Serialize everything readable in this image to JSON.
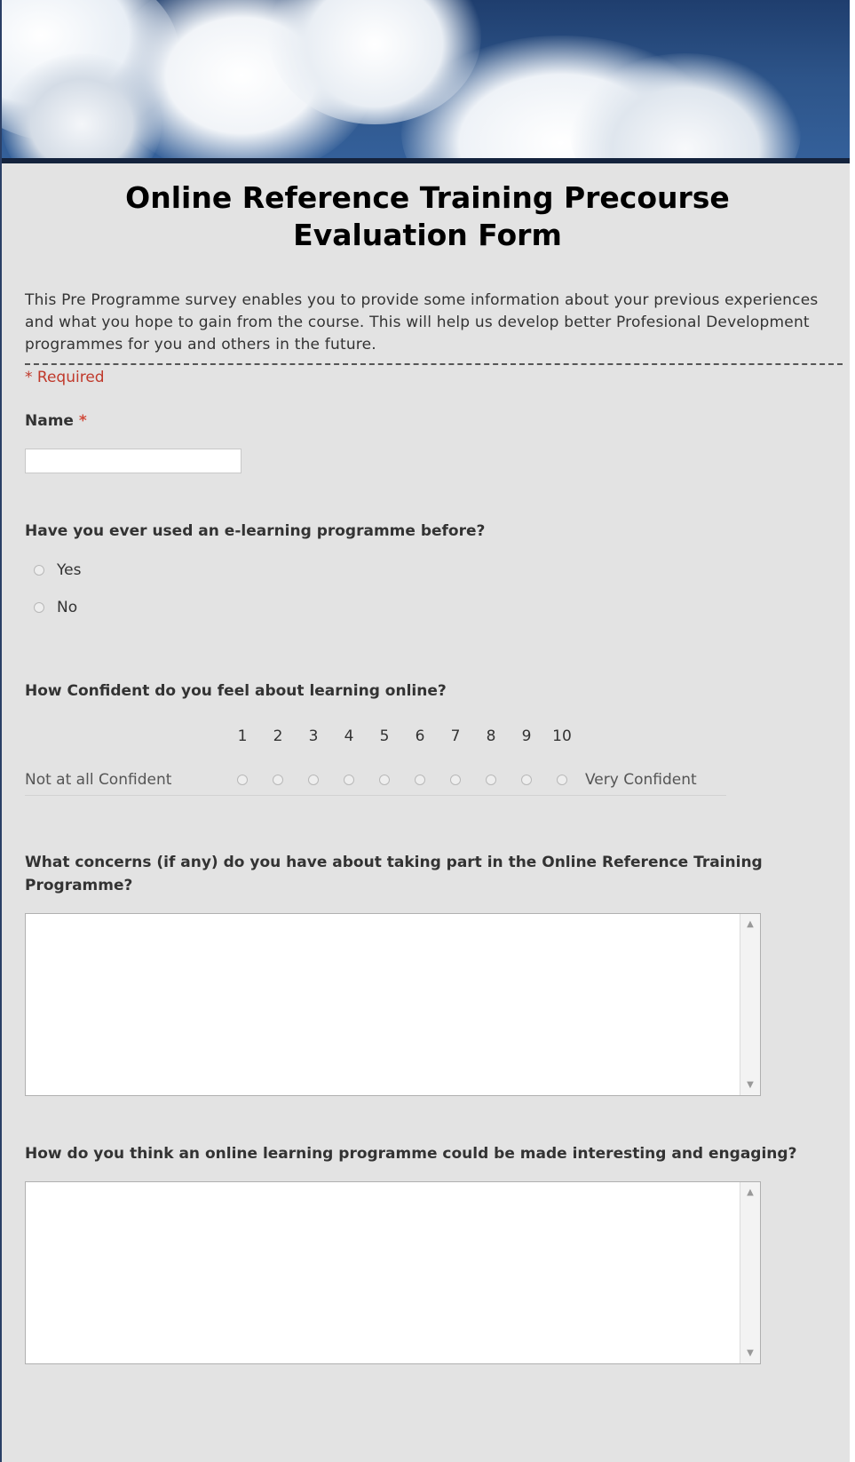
{
  "form": {
    "title": "Online Reference Training Precourse Evaluation Form",
    "description": "This Pre Programme survey enables you to provide some information about your previous experiences and what you hope to gain from the course. This will help us develop better Profesional Development programmes for you and others in the future.",
    "required_note": "Required",
    "required_star": "*"
  },
  "q_name": {
    "label": "Name",
    "star": "*",
    "value": ""
  },
  "q_elearning": {
    "label": "Have you ever used an e-learning programme before?",
    "options": [
      "Yes",
      "No"
    ]
  },
  "q_confidence": {
    "label": "How Confident do you feel about learning online?",
    "scale": [
      "1",
      "2",
      "3",
      "4",
      "5",
      "6",
      "7",
      "8",
      "9",
      "10"
    ],
    "low_label": "Not at all Confident",
    "high_label": "Very Confident"
  },
  "q_concerns": {
    "label": "What concerns (if any) do you have about taking part in the Online Reference Training Programme?",
    "value": ""
  },
  "q_engaging": {
    "label": "How do you think an online learning programme could be made interesting and engaging?",
    "value": ""
  },
  "icons": {
    "scroll_up": "up-arrow-icon",
    "scroll_down": "down-arrow-icon"
  }
}
